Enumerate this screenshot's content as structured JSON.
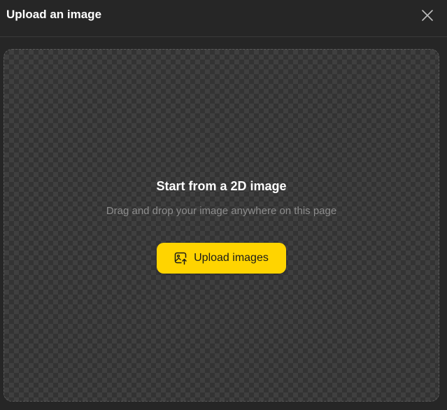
{
  "dialog": {
    "title": "Upload an image",
    "close_icon": "close-icon"
  },
  "dropzone": {
    "heading": "Start from a 2D image",
    "subtext": "Drag and drop your image anywhere on this page",
    "upload_button": {
      "label": "Upload images",
      "icon": "image-upload-icon"
    }
  },
  "colors": {
    "background": "#262626",
    "accent": "#ffd400",
    "heading_text": "#ffffff",
    "muted_text": "#8d8d8d"
  }
}
